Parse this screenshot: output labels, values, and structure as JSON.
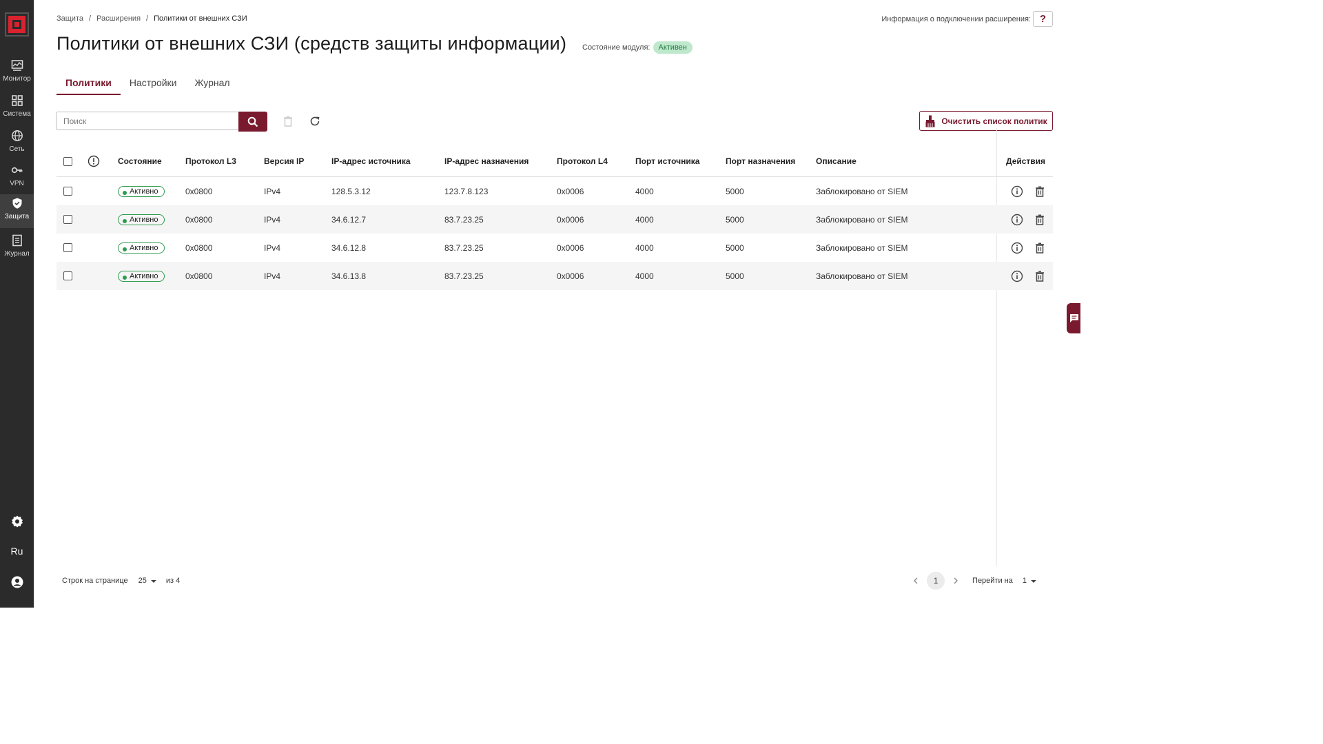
{
  "sidebar": {
    "items": [
      {
        "label": "Монитор",
        "icon": "monitor-icon"
      },
      {
        "label": "Система",
        "icon": "grid-icon"
      },
      {
        "label": "Сеть",
        "icon": "globe-icon"
      },
      {
        "label": "VPN",
        "icon": "key-icon"
      },
      {
        "label": "Защита",
        "icon": "shield-icon",
        "active": true
      },
      {
        "label": "Журнал",
        "icon": "journal-icon"
      }
    ],
    "language": "Ru"
  },
  "breadcrumb": [
    "Защита",
    "Расширения",
    "Политики от внешних СЗИ"
  ],
  "help": {
    "label": "Информация о подключении расширения:",
    "button": "?"
  },
  "page_title": "Политики от внешних СЗИ (средств защиты информации)",
  "module_state": {
    "label": "Состояние модуля:",
    "value": "Активен"
  },
  "tabs": [
    "Политики",
    "Настройки",
    "Журнал"
  ],
  "search": {
    "placeholder": "Поиск"
  },
  "clear_button": "Очистить список политик",
  "table": {
    "headers": [
      "Состояние",
      "Протокол L3",
      "Версия IP",
      "IP-адрес источника",
      "IP-адрес назначения",
      "Протокол L4",
      "Порт источника",
      "Порт назначения",
      "Описание",
      "Действия"
    ],
    "rows": [
      {
        "status": "Активно",
        "l3": "0x0800",
        "ipver": "IPv4",
        "src_ip": "128.5.3.12",
        "dst_ip": "123.7.8.123",
        "l4": "0x0006",
        "src_port": "4000",
        "dst_port": "5000",
        "desc": "Заблокировано от SIEM"
      },
      {
        "status": "Активно",
        "l3": "0x0800",
        "ipver": "IPv4",
        "src_ip": "34.6.12.7",
        "dst_ip": "83.7.23.25",
        "l4": "0x0006",
        "src_port": "4000",
        "dst_port": "5000",
        "desc": "Заблокировано от SIEM"
      },
      {
        "status": "Активно",
        "l3": "0x0800",
        "ipver": "IPv4",
        "src_ip": "34.6.12.8",
        "dst_ip": "83.7.23.25",
        "l4": "0x0006",
        "src_port": "4000",
        "dst_port": "5000",
        "desc": "Заблокировано от SIEM"
      },
      {
        "status": "Активно",
        "l3": "0x0800",
        "ipver": "IPv4",
        "src_ip": "34.6.13.8",
        "dst_ip": "83.7.23.25",
        "l4": "0x0006",
        "src_port": "4000",
        "dst_port": "5000",
        "desc": "Заблокировано от SIEM"
      }
    ]
  },
  "pagination": {
    "rows_per_page_label": "Строк на странице",
    "rows_per_page": "25",
    "of_label": "из 4",
    "current_page": "1",
    "goto_label": "Перейти на",
    "goto_value": "1"
  },
  "colors": {
    "brand": "#7a1a2f",
    "sidebar": "#2b2b2b",
    "status_green": "#2e9b4f"
  }
}
